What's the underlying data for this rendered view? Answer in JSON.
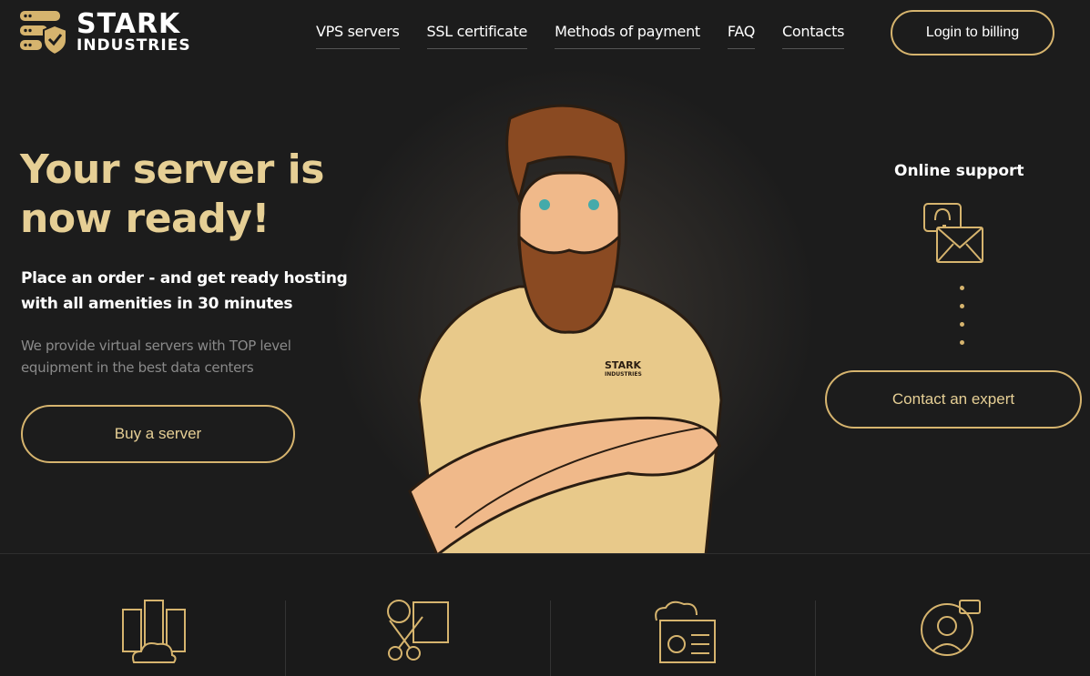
{
  "logo": {
    "line1": "STARK",
    "line2": "INDUSTRIES"
  },
  "nav": [
    {
      "label": "VPS servers"
    },
    {
      "label": "SSL certificate"
    },
    {
      "label": "Methods of payment"
    },
    {
      "label": "FAQ"
    },
    {
      "label": "Contacts"
    }
  ],
  "login_label": "Login to billing",
  "hero": {
    "title_line1": "Your server is",
    "title_line2": "now ready!",
    "subtitle_line1": "Place an order - and get ready hosting",
    "subtitle_line2": "with all amenities in 30 minutes",
    "desc_line1": "We provide virtual servers with TOP level",
    "desc_line2": "equipment in the best data centers",
    "buy_label": "Buy a server",
    "shirt_logo_1": "STARK",
    "shirt_logo_2": "INDUSTRIES"
  },
  "support": {
    "title": "Online support",
    "contact_label": "Contact an expert"
  },
  "colors": {
    "accent": "#d6b46e",
    "background": "#1c1c1c"
  },
  "features": [
    {
      "icon": "server-cloud-icon"
    },
    {
      "icon": "discount-coupon-icon"
    },
    {
      "icon": "cloud-settings-icon"
    },
    {
      "icon": "support-agent-icon"
    }
  ]
}
